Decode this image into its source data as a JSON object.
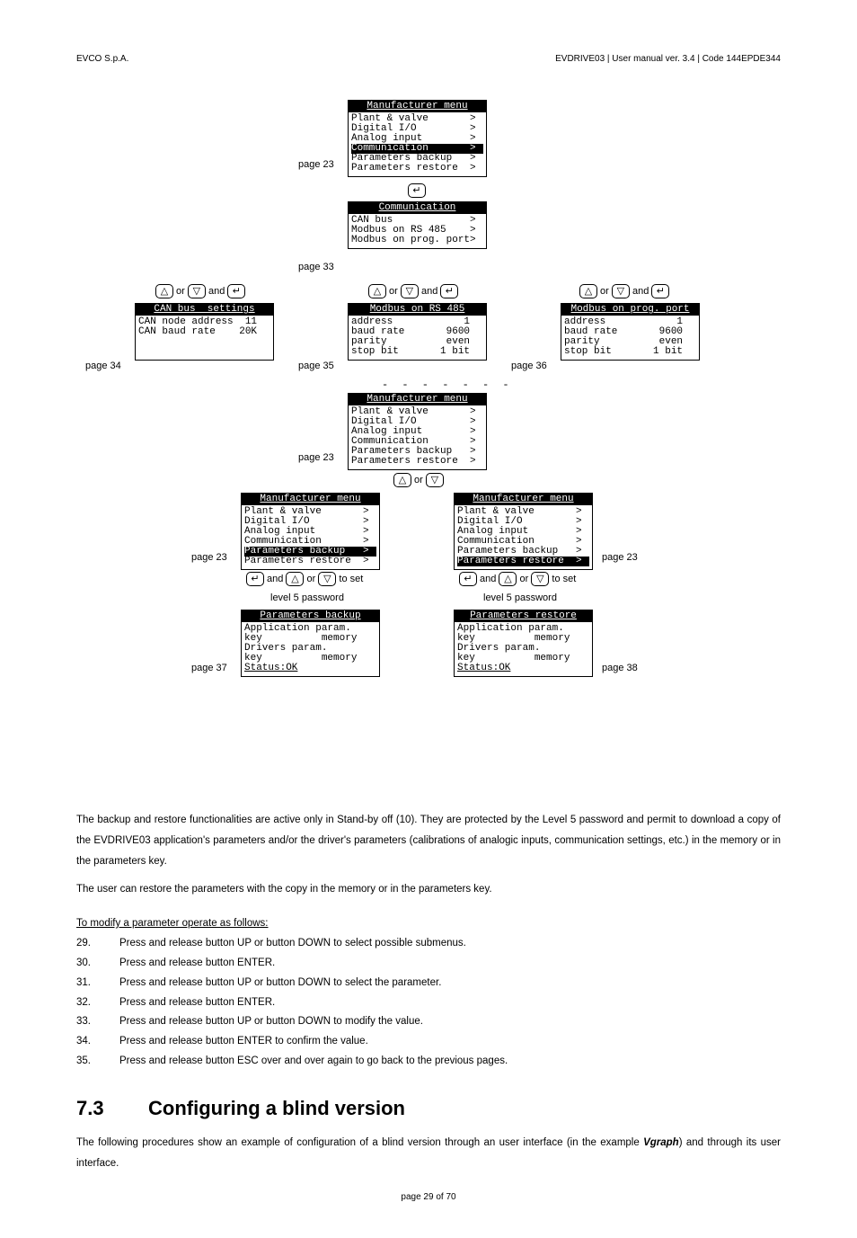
{
  "header": {
    "left": "EVCO S.p.A.",
    "right": "EVDRIVE03 | User manual ver. 3.4 | Code 144EPDE344"
  },
  "labels": {
    "page23a": "page 23",
    "page33": "page 33",
    "page34": "page 34",
    "page35": "page 35",
    "page36": "page 36",
    "page23b": "page 23",
    "page23c": "page 23",
    "page23d": "page 23",
    "page37": "page 37",
    "page38": "page 38",
    "or": " or ",
    "and": " and ",
    "toset": " to set",
    "level5a": "level 5 password",
    "level5b": "level 5 password",
    "dashes": "- - - - - - -"
  },
  "lcd": {
    "menu1": {
      "title": "Manufacturer menu",
      "body": "Plant & valve       >\nDigital I/O         >\nAnalog input        >\nCommunication       >\nParameters backup   >\nParameters restore  >",
      "hl_line": 3
    },
    "comm": {
      "title": "Communication",
      "body": "CAN bus             >\nModbus on RS 485    >\nModbus on prog. port>"
    },
    "can": {
      "title": "CAN bus  settings",
      "body": "CAN node address  11\nCAN baud rate    20K\n\n\n"
    },
    "rs485": {
      "title": "Modbus on RS 485",
      "body": "address            1\nbaud rate       9600\nparity          even\nstop bit       1 bit\n"
    },
    "prog": {
      "title": "Modbus on prog. port",
      "body": "address            1\nbaud rate       9600\nparity          even\nstop bit       1 bit\n"
    },
    "menu2": {
      "title": "Manufacturer menu",
      "body": "Plant & valve       >\nDigital I/O         >\nAnalog input        >\nCommunication       >\nParameters backup   >\nParameters restore  >"
    },
    "menuBackup": {
      "title": "Manufacturer menu",
      "body": "Plant & valve       >\nDigital I/O         >\nAnalog input        >\nCommunication       >\nParameters backup   >\nParameters restore  >",
      "hl_line": 4
    },
    "menuRestore": {
      "title": "Manufacturer menu",
      "body": "Plant & valve       >\nDigital I/O         >\nAnalog input        >\nCommunication       >\nParameters backup   >\nParameters restore  >",
      "hl_line": 5
    },
    "backup": {
      "title": "Parameters backup",
      "body": "Application param.\nkey          memory\nDrivers param.\nkey          memory\nStatus:OK",
      "underline_last": true
    },
    "restore": {
      "title": "Parameters restore",
      "body": "Application param.\nkey          memory\nDrivers param.\nkey          memory\nStatus:OK",
      "underline_last": true
    }
  },
  "paragraphs": {
    "p1": "The backup and restore functionalities are active only in Stand-by off (10). They are protected by the Level 5 password and permit to download a copy of the EVDRIVE03 application's parameters and/or the driver's parameters (calibrations of analogic inputs, communication settings, etc.) in the memory or in the parameters key.",
    "p2": "The user can restore the parameters with the copy in the memory or in the parameters key.",
    "modify_head": "To modify a parameter operate as follows:"
  },
  "steps": [
    {
      "n": "29.",
      "t": "Press and release button UP or button DOWN to select possible submenus."
    },
    {
      "n": "30.",
      "t": "Press and release button ENTER."
    },
    {
      "n": "31.",
      "t": "Press and release button UP or button DOWN to select the parameter."
    },
    {
      "n": "32.",
      "t": "Press and release button ENTER."
    },
    {
      "n": "33.",
      "t": "Press and release button UP or button DOWN to modify the value."
    },
    {
      "n": "34.",
      "t": "Press and release button ENTER to confirm the value."
    },
    {
      "n": "35.",
      "t": "Press and release button ESC over and over again to go back to the previous pages."
    }
  ],
  "section": {
    "num": "7.3",
    "title": "Configuring a blind version",
    "text_before": "The following procedures show an example of configuration of a blind version through an user interface (in the example ",
    "bold": "Vgraph",
    "text_after": ") and through its user interface."
  },
  "footer": "page 29 of 70"
}
